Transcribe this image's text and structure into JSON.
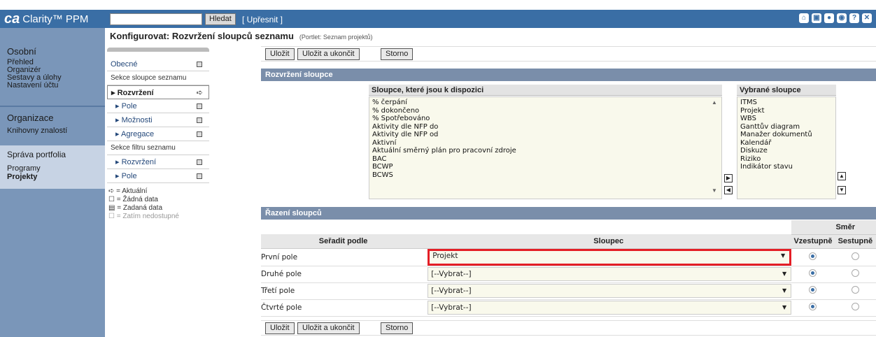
{
  "header": {
    "logo_mark": "ca",
    "logo_text": "Clarity™ PPM",
    "search_button": "Hledat",
    "refine_link": "[ Upřesnit ]",
    "icons": [
      "home-icon",
      "bookmark-icon",
      "help-icon",
      "settings-icon",
      "close-icon"
    ]
  },
  "nav": {
    "osobni": "Osobní",
    "prehled": "Přehled",
    "organizer": "Organizér",
    "sestavy": "Sestavy a úlohy",
    "nastaveni": "Nastavení účtu",
    "organizace": "Organizace",
    "knihovny": "Knihovny znalostí",
    "sprava": "Správa portfolia",
    "programy": "Programy",
    "projekty": "Projekty"
  },
  "page": {
    "title": "Konfigurovat: Rozvržení sloupců seznamu",
    "subtitle": "(Portlet: Seznam projektů)"
  },
  "side": {
    "obecne": "Obecné",
    "sekce_sloupce": "Sekce sloupce seznamu",
    "rozvrzeni": "Rozvržení",
    "pole": "Pole",
    "moznosti": "Možnosti",
    "agregace": "Agregace",
    "sekce_filtru": "Sekce filtru seznamu",
    "rozvrzeni2": "Rozvržení",
    "pole2": "Pole"
  },
  "legend": {
    "aktualni": "= Aktuální",
    "zadna": "= Žádná data",
    "zadana": "= Zadaná data",
    "zatim": "= Zatím nedostupné"
  },
  "toolbar": {
    "ulozit": "Uložit",
    "ulozit_ukoncit": "Uložit a ukončit",
    "storno": "Storno"
  },
  "layout": {
    "heading": "Rozvržení sloupce",
    "available_header": "Sloupce, které jsou k dispozici",
    "available": [
      "% čerpání",
      "% dokončeno",
      "% Spotřebováno",
      "Aktivity dle NFP do",
      "Aktivity dle NFP od",
      "Aktivní",
      "Aktuální směrný plán pro pracovní zdroje",
      "BAC",
      "BCWP",
      "BCWS"
    ],
    "selected_header": "Vybrané sloupce",
    "selected": [
      "ITMS",
      "Projekt",
      "WBS",
      "Ganttův diagram",
      "Manažer dokumentů",
      "Kalendář",
      "Diskuze",
      "Riziko",
      "Indikátor stavu"
    ]
  },
  "sort": {
    "heading": "Řazení sloupců",
    "col_sortby": "Seřadit podle",
    "col_column": "Sloupec",
    "col_direction": "Směr",
    "asc": "Vzestupně",
    "desc": "Sestupně",
    "rows": [
      {
        "label": "První pole",
        "value": "Projekt"
      },
      {
        "label": "Druhé pole",
        "value": "[--Vybrat--]"
      },
      {
        "label": "Třetí pole",
        "value": "[--Vybrat--]"
      },
      {
        "label": "Čtvrté pole",
        "value": "[--Vybrat--]"
      }
    ]
  }
}
